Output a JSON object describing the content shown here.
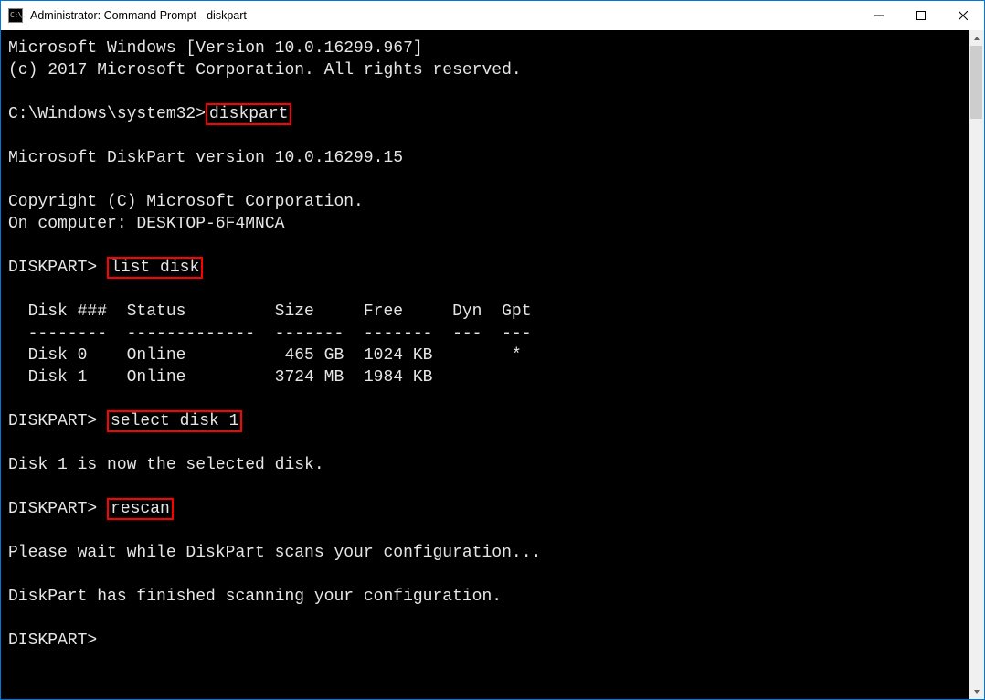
{
  "window": {
    "title": "Administrator: Command Prompt - diskpart"
  },
  "icon_label": "C:\\.",
  "terminal": {
    "line_version": "Microsoft Windows [Version 10.0.16299.967]",
    "line_copyright": "(c) 2017 Microsoft Corporation. All rights reserved.",
    "prompt_sys32": "C:\\Windows\\system32>",
    "cmd_diskpart": "diskpart",
    "line_diskpart_version": "Microsoft DiskPart version 10.0.16299.15",
    "line_copyright2": "Copyright (C) Microsoft Corporation.",
    "line_on_computer": "On computer: DESKTOP-6F4MNCA",
    "prompt_diskpart": "DISKPART> ",
    "cmd_list_disk": "list disk",
    "table_header": "  Disk ###  Status         Size     Free     Dyn  Gpt",
    "table_divider": "  --------  -------------  -------  -------  ---  ---",
    "table_row0": "  Disk 0    Online          465 GB  1024 KB        *",
    "table_row1": "  Disk 1    Online         3724 MB  1984 KB",
    "cmd_select_disk": "select disk 1",
    "line_selected": "Disk 1 is now the selected disk.",
    "cmd_rescan": "rescan",
    "line_wait": "Please wait while DiskPart scans your configuration...",
    "line_finished": "DiskPart has finished scanning your configuration.",
    "prompt_last": "DISKPART>"
  },
  "chart_data": {
    "type": "table",
    "title": "list disk",
    "columns": [
      "Disk ###",
      "Status",
      "Size",
      "Free",
      "Dyn",
      "Gpt"
    ],
    "rows": [
      {
        "Disk ###": "Disk 0",
        "Status": "Online",
        "Size": "465 GB",
        "Free": "1024 KB",
        "Dyn": "",
        "Gpt": "*"
      },
      {
        "Disk ###": "Disk 1",
        "Status": "Online",
        "Size": "3724 MB",
        "Free": "1984 KB",
        "Dyn": "",
        "Gpt": ""
      }
    ]
  }
}
